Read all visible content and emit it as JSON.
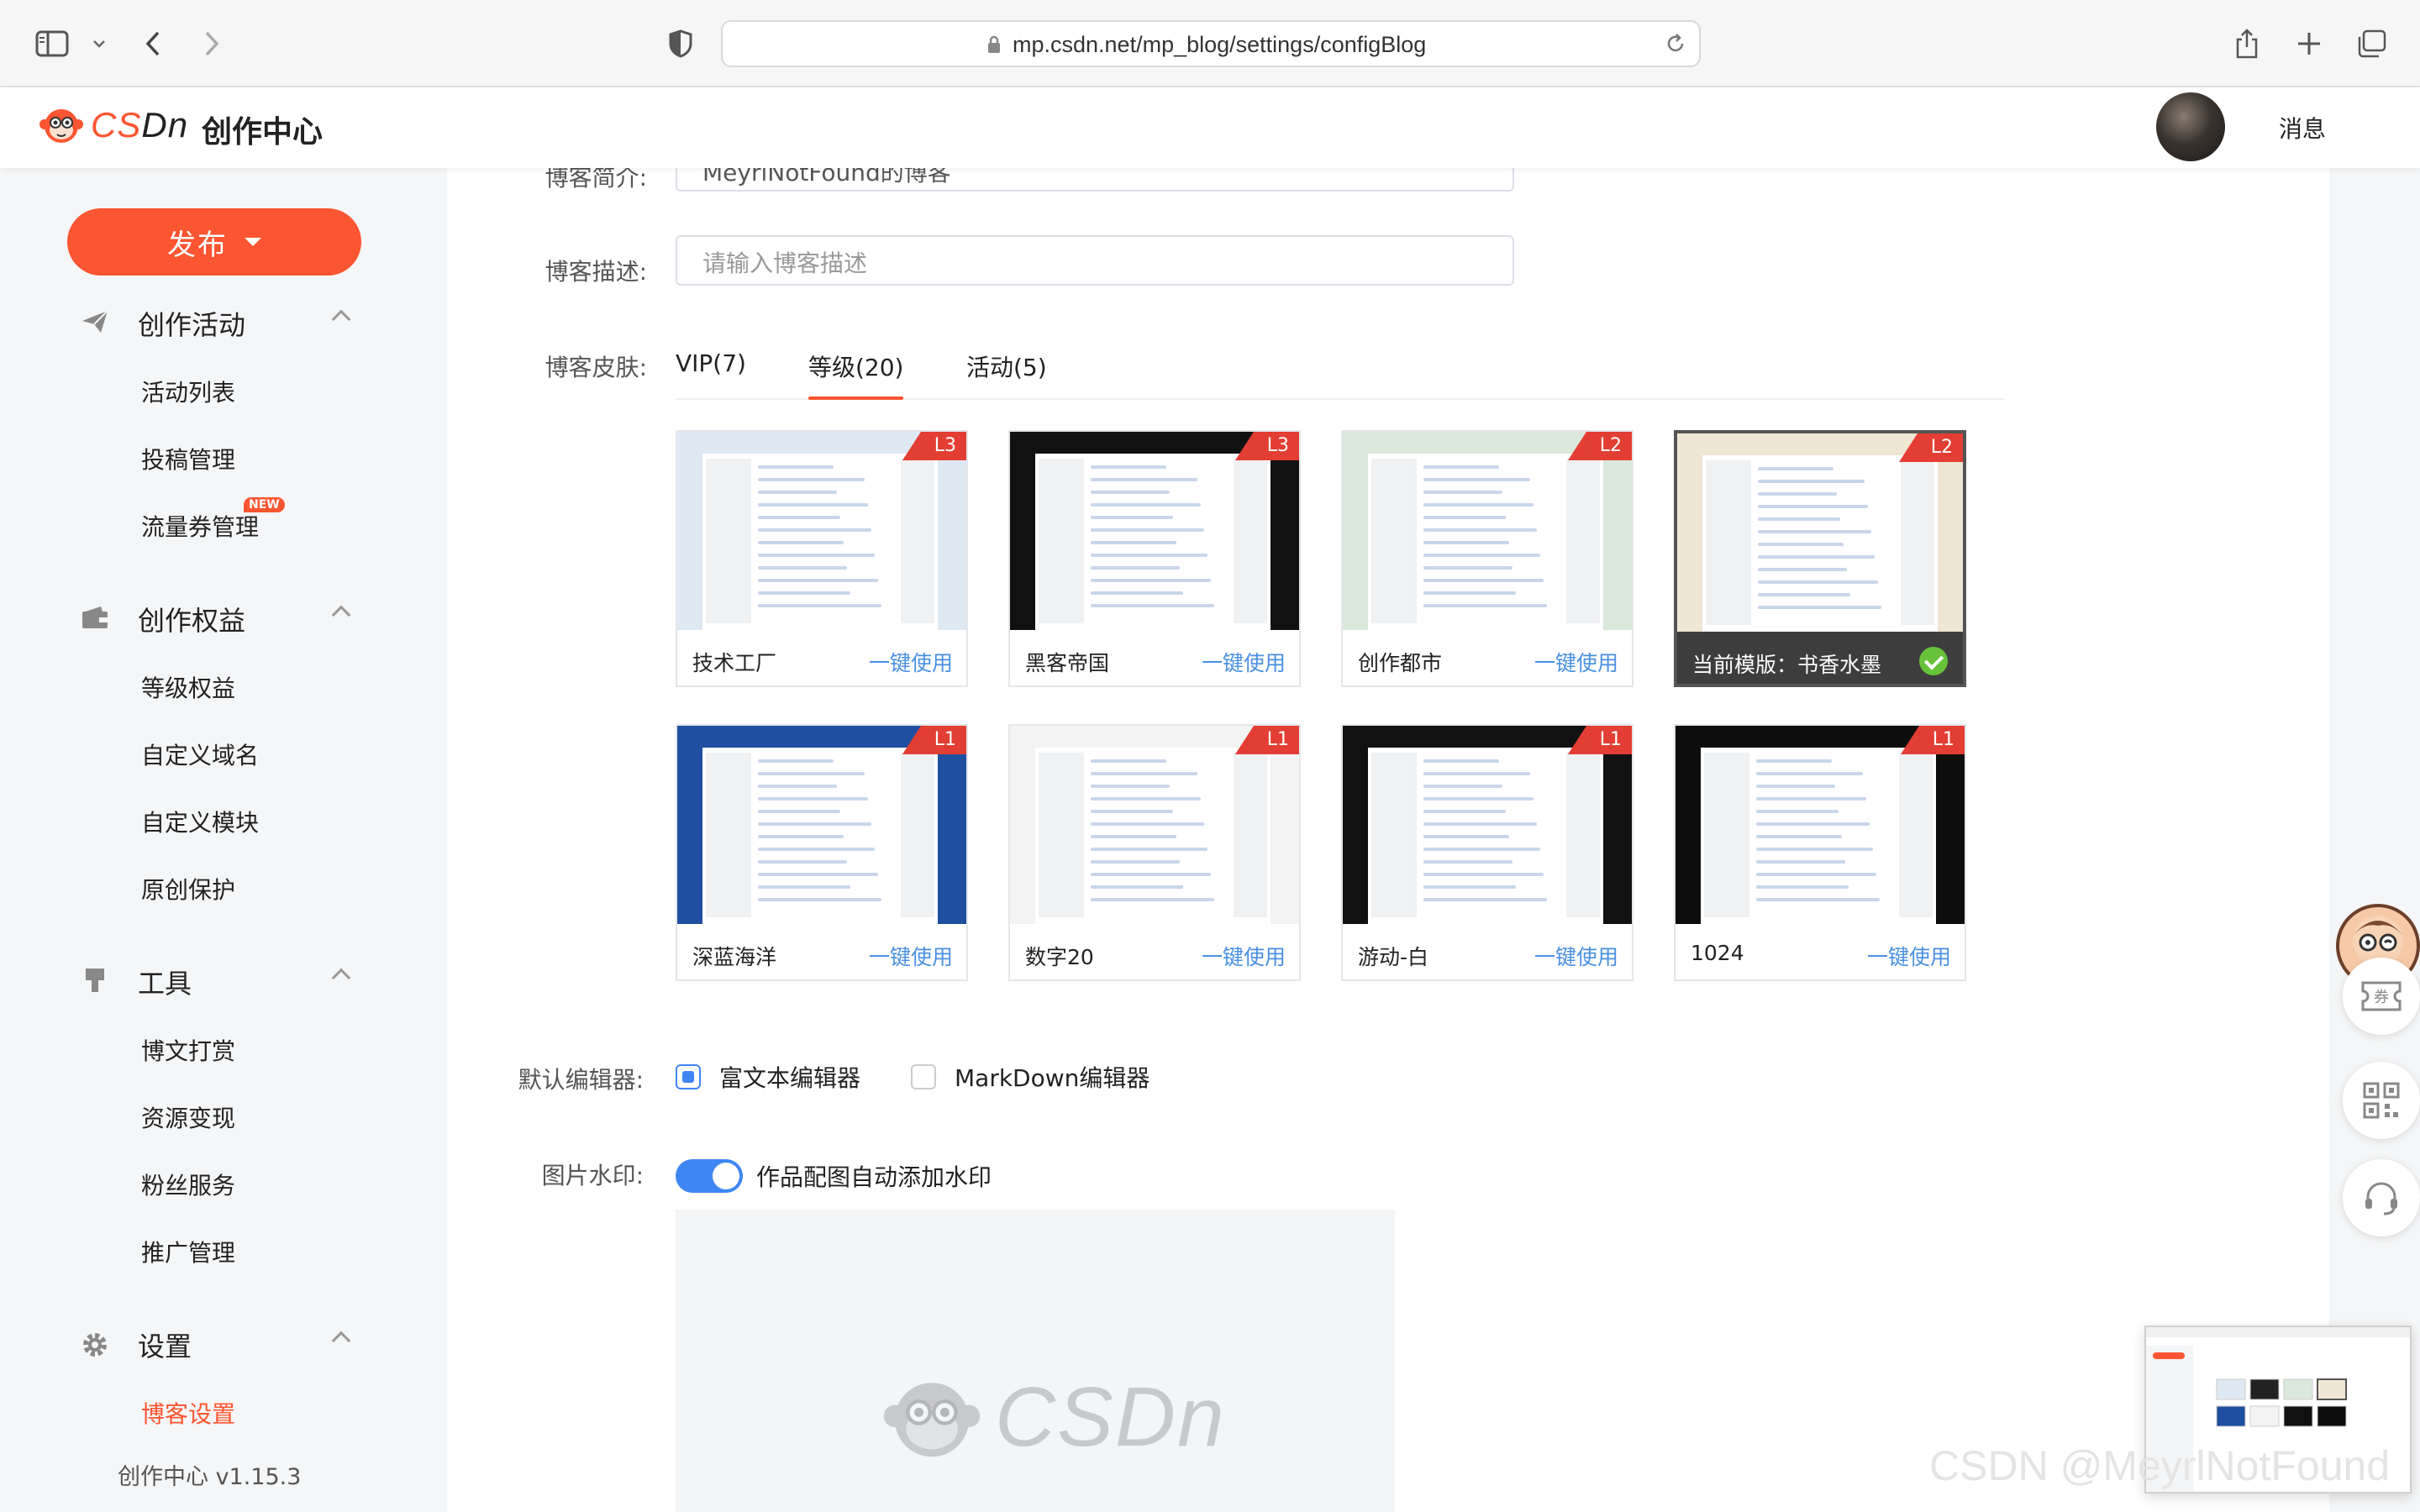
{
  "browser": {
    "url": "mp.csdn.net/mp_blog/settings/configBlog"
  },
  "header": {
    "logo_text_c": "CS",
    "logo_text_dn": "Dn",
    "title": "创作中心",
    "messages": "消息"
  },
  "sidebar": {
    "publish": "发布",
    "groups": [
      {
        "label": "创作活动",
        "icon": "paper-plane-icon",
        "items": [
          "活动列表",
          "投稿管理",
          "流量券管理"
        ]
      },
      {
        "label": "创作权益",
        "icon": "wallet-icon",
        "items": [
          "等级权益",
          "自定义域名",
          "自定义模块",
          "原创保护"
        ]
      },
      {
        "label": "工具",
        "icon": "brush-icon",
        "items": [
          "博文打赏",
          "资源变现",
          "粉丝服务",
          "推广管理"
        ]
      },
      {
        "label": "设置",
        "icon": "gear-icon",
        "items": [
          "博客设置"
        ]
      }
    ],
    "new_badge": "NEW",
    "active_item": "博客设置",
    "version": "创作中心 v1.15.3"
  },
  "form": {
    "intro_label": "博客简介:",
    "intro_value": "MeyrlNotFound的博客",
    "desc_label": "博客描述:",
    "desc_placeholder": "请输入博客描述",
    "skin_label": "博客皮肤:",
    "tabs": [
      "VIP(7)",
      "等级(20)",
      "活动(5)"
    ],
    "active_tab": "等级(20)",
    "skins": [
      {
        "name": "技术工厂",
        "level": "L3",
        "action": "一键使用",
        "theme": "#dfe9f3"
      },
      {
        "name": "黑客帝国",
        "level": "L3",
        "action": "一键使用",
        "theme": "#111111"
      },
      {
        "name": "创作都市",
        "level": "L2",
        "action": "一键使用",
        "theme": "#dbe8dc"
      },
      {
        "name": "当前模版：书香水墨",
        "level": "L2",
        "action": "",
        "theme": "#efe6d4",
        "selected": true
      },
      {
        "name": "深蓝海洋",
        "level": "L1",
        "action": "一键使用",
        "theme": "#1f4fa0"
      },
      {
        "name": "数字20",
        "level": "L1",
        "action": "一键使用",
        "theme": "#f3f3f3"
      },
      {
        "name": "游动-白",
        "level": "L1",
        "action": "一键使用",
        "theme": "#111111"
      },
      {
        "name": "1024",
        "level": "L1",
        "action": "一键使用",
        "theme": "#0d0d0d"
      }
    ],
    "editor_label": "默认编辑器:",
    "editor_options": [
      "富文本编辑器",
      "MarkDown编辑器"
    ],
    "editor_selected": "富文本编辑器",
    "watermark_label": "图片水印:",
    "watermark_toggle_label": "作品配图自动添加水印",
    "watermark_enabled": true,
    "watermark_preview_text": "CSDn"
  },
  "overlay": {
    "corner_watermark": "CSDN @MeyrlNotFound"
  },
  "colors": {
    "brand": "#fc5531",
    "link": "#4a90e2",
    "accent_blue": "#3f86f5",
    "level_tag": "#e33e33"
  }
}
